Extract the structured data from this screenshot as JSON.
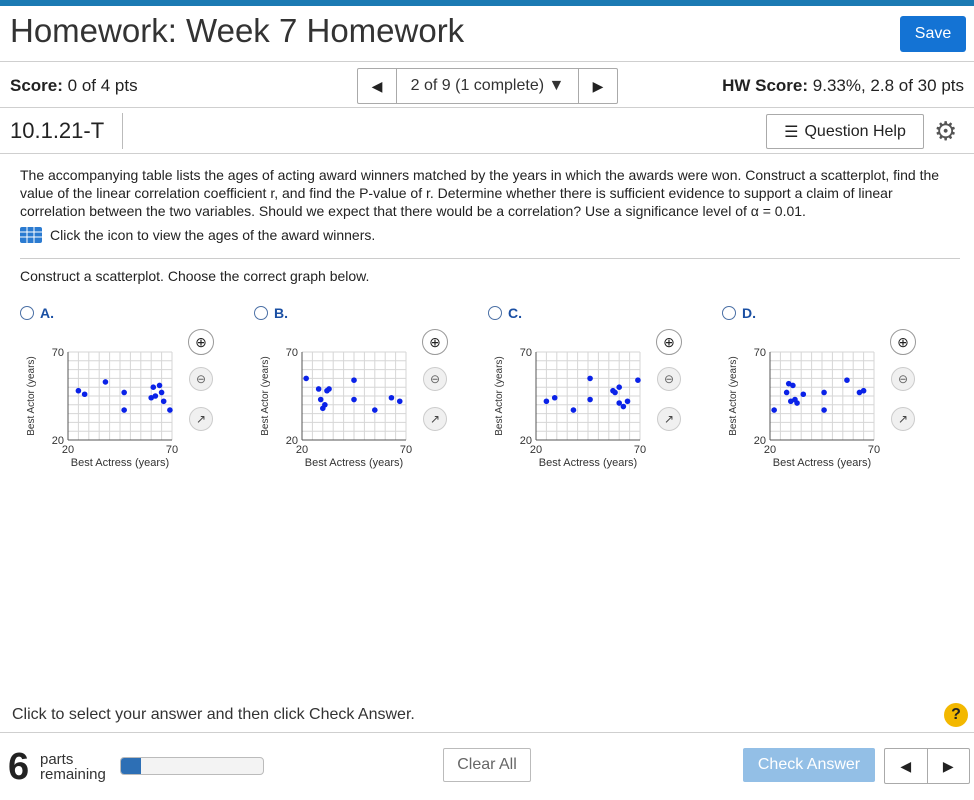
{
  "header": {
    "title": "Homework: Week 7 Homework",
    "save_label": "Save"
  },
  "status": {
    "score_label": "Score:",
    "score_value": "0 of 4 pts",
    "nav_label": "2 of 9 (1 complete)",
    "hw_label": "HW Score:",
    "hw_value": "9.33%, 2.8 of 30 pts"
  },
  "question": {
    "id": "10.1.21-T",
    "help_label": "Question Help",
    "prompt": "The accompanying table lists the ages of acting award winners matched by the years in which the awards were won. Construct a scatterplot, find the value of the linear correlation coefficient r, and find the P-value of r. Determine whether there is sufficient evidence to support a claim of linear correlation between the two variables. Should we expect that there would be a correlation? Use a significance level of α = 0.01.",
    "table_link": "Click the icon to view the ages of the award winners.",
    "subprompt": "Construct a scatterplot. Choose the correct graph below."
  },
  "chart_data": [
    {
      "type": "scatter",
      "title": "A.",
      "xlabel": "Best Actress (years)",
      "ylabel": "Best Actor (years)",
      "xlim": [
        20,
        70
      ],
      "ylim": [
        20,
        70
      ],
      "x_ticks": [
        "20",
        "70"
      ],
      "y_ticks": [
        "20",
        "70"
      ],
      "points": [
        [
          25,
          48
        ],
        [
          28,
          46
        ],
        [
          38,
          53
        ],
        [
          47,
          47
        ],
        [
          47,
          37
        ],
        [
          60,
          44
        ],
        [
          61,
          50
        ],
        [
          62,
          45
        ],
        [
          64,
          51
        ],
        [
          65,
          47
        ],
        [
          66,
          42
        ],
        [
          69,
          37
        ]
      ]
    },
    {
      "type": "scatter",
      "title": "B.",
      "xlabel": "Best Actress (years)",
      "ylabel": "Best Actor (years)",
      "xlim": [
        20,
        70
      ],
      "ylim": [
        20,
        70
      ],
      "x_ticks": [
        "20",
        "70"
      ],
      "y_ticks": [
        "20",
        "70"
      ],
      "points": [
        [
          22,
          55
        ],
        [
          28,
          49
        ],
        [
          29,
          43
        ],
        [
          30,
          38
        ],
        [
          31,
          40
        ],
        [
          32,
          48
        ],
        [
          33,
          49
        ],
        [
          45,
          54
        ],
        [
          45,
          43
        ],
        [
          55,
          37
        ],
        [
          63,
          44
        ],
        [
          67,
          42
        ]
      ]
    },
    {
      "type": "scatter",
      "title": "C.",
      "xlabel": "Best Actress (years)",
      "ylabel": "Best Actor (years)",
      "xlim": [
        20,
        70
      ],
      "ylim": [
        20,
        70
      ],
      "x_ticks": [
        "20",
        "70"
      ],
      "y_ticks": [
        "20",
        "70"
      ],
      "points": [
        [
          25,
          42
        ],
        [
          29,
          44
        ],
        [
          38,
          37
        ],
        [
          46,
          55
        ],
        [
          46,
          43
        ],
        [
          57,
          48
        ],
        [
          58,
          47
        ],
        [
          60,
          50
        ],
        [
          60,
          41
        ],
        [
          62,
          39
        ],
        [
          64,
          42
        ],
        [
          69,
          54
        ]
      ]
    },
    {
      "type": "scatter",
      "title": "D.",
      "xlabel": "Best Actress (years)",
      "ylabel": "Best Actor (years)",
      "xlim": [
        20,
        70
      ],
      "ylim": [
        20,
        70
      ],
      "x_ticks": [
        "20",
        "70"
      ],
      "y_ticks": [
        "20",
        "70"
      ],
      "points": [
        [
          22,
          37
        ],
        [
          28,
          47
        ],
        [
          29,
          52
        ],
        [
          30,
          42
        ],
        [
          31,
          51
        ],
        [
          33,
          41
        ],
        [
          32,
          43
        ],
        [
          36,
          46
        ],
        [
          46,
          37
        ],
        [
          46,
          47
        ],
        [
          57,
          54
        ],
        [
          63,
          47
        ],
        [
          65,
          48
        ]
      ]
    }
  ],
  "instruction": "Click to select your answer and then click Check Answer.",
  "footer": {
    "parts_number": "6",
    "parts_line1": "parts",
    "parts_line2": "remaining",
    "progress_fraction": 0.14,
    "clear_label": "Clear All",
    "check_label": "Check Answer"
  }
}
